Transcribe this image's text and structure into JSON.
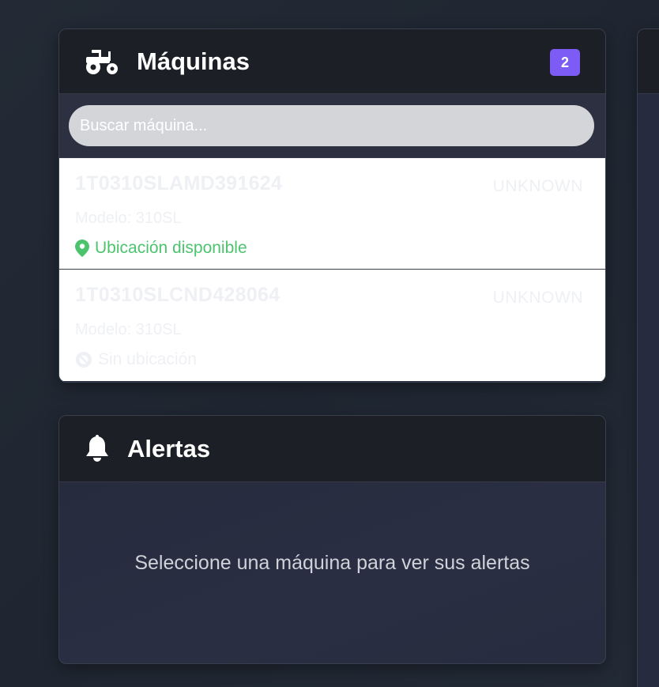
{
  "machines_panel": {
    "title": "Máquinas",
    "icon": "tractor-icon",
    "count": "2",
    "search_placeholder": "Buscar máquina...",
    "items": [
      {
        "id": "1T0310SLAMD391624",
        "status": "UNKNOWN",
        "model": "Modelo: 310SL",
        "location": "Ubicación disponible",
        "location_icon": "map-marker-icon",
        "location_available": true
      },
      {
        "id": "1T0310SLCND428064",
        "status": "UNKNOWN",
        "model": "Modelo: 310SL",
        "location": "Sin ubicación",
        "location_icon": "ban-icon",
        "location_available": false
      }
    ]
  },
  "alerts_panel": {
    "title": "Alertas",
    "icon": "bell-icon",
    "empty_message": "Seleccione una máquina para ver sus alertas"
  },
  "colors": {
    "accent": "#7c5cf5",
    "location_ok": "#4cc46e",
    "header_bg": "#1c1f25",
    "panel_bg": "#262b3f"
  }
}
